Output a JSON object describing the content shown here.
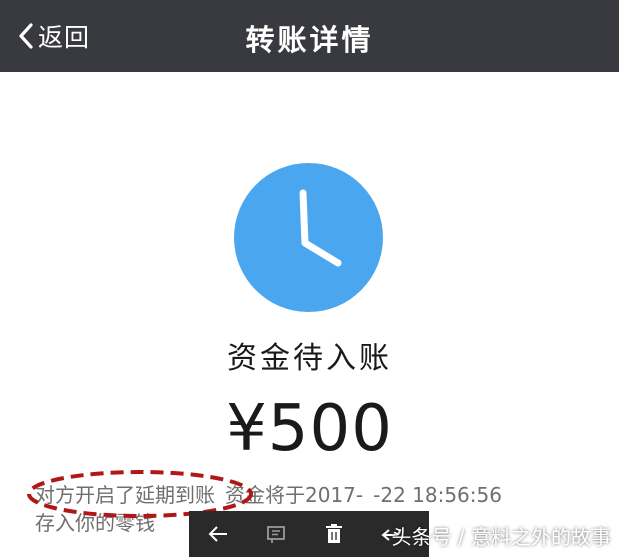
{
  "header": {
    "back_label": "返回",
    "title": "转账详情"
  },
  "status": {
    "icon": "clock-icon",
    "text": "资金待入账",
    "amount": "¥500"
  },
  "note": {
    "line1_part1": "对方开启了延期到账",
    "line1_part2": "资金将于2017-",
    "line1_part3": "-22 18:56:56",
    "line2": "存入你的零钱"
  },
  "toolbar": {
    "icons": [
      "arrow-left-icon",
      "comment-icon",
      "trash-icon",
      "share-icon"
    ]
  },
  "watermark": {
    "text": "头条号 / 意料之外的故事"
  },
  "colors": {
    "navbar_bg": "#393a3f",
    "clock_blue": "#4aa6ee",
    "highlight_red": "#b01818",
    "note_text": "#6f6f6f"
  }
}
